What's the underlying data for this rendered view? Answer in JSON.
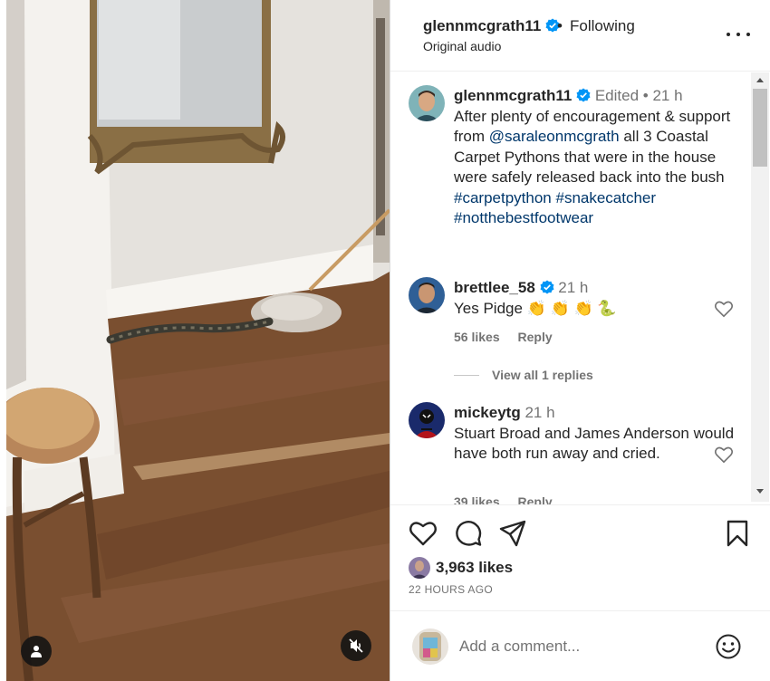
{
  "post": {
    "username": "glennmcgrath11",
    "separator": "•",
    "follow_status": "Following",
    "audio": "Original audio"
  },
  "caption": {
    "username": "glennmcgrath11",
    "edited": "Edited",
    "dot": "•",
    "time": "21 h",
    "text_before": "After plenty of encouragement & support from ",
    "mention": "@saraleonmcgrath",
    "text_after": " all 3 Coastal Carpet Pythons that were in the house were safely released back into the bush ",
    "hashtags": [
      "#carpetpython",
      "#snakecatcher",
      "#notthebestfootwear"
    ]
  },
  "comments": [
    {
      "username": "brettlee_58",
      "verified": true,
      "time": "21 h",
      "text": "Yes Pidge 👏 👏 👏 🐍",
      "likes": "56 likes",
      "reply": "Reply",
      "view_replies": "View all 1 replies"
    },
    {
      "username": "mickeytg",
      "verified": false,
      "time": "21 h",
      "text": "Stuart Broad and James Anderson would have both run away and cried.",
      "likes": "39 likes",
      "reply": "Reply"
    }
  ],
  "stats": {
    "likes": "3,963 likes",
    "time_ago": "22 HOURS AGO"
  },
  "add_comment": {
    "placeholder": "Add a comment..."
  },
  "icons": {
    "tag": "person-tag-icon",
    "mute": "speaker-muted-icon",
    "more": "more-options-icon",
    "like": "heart-icon",
    "comment": "comment-icon",
    "share": "paper-plane-icon",
    "save": "bookmark-icon",
    "emoji": "emoji-icon",
    "verified": "verified-badge-icon"
  },
  "colors": {
    "link": "#00376b",
    "verified": "#0095f6",
    "muted_text": "#737373"
  }
}
